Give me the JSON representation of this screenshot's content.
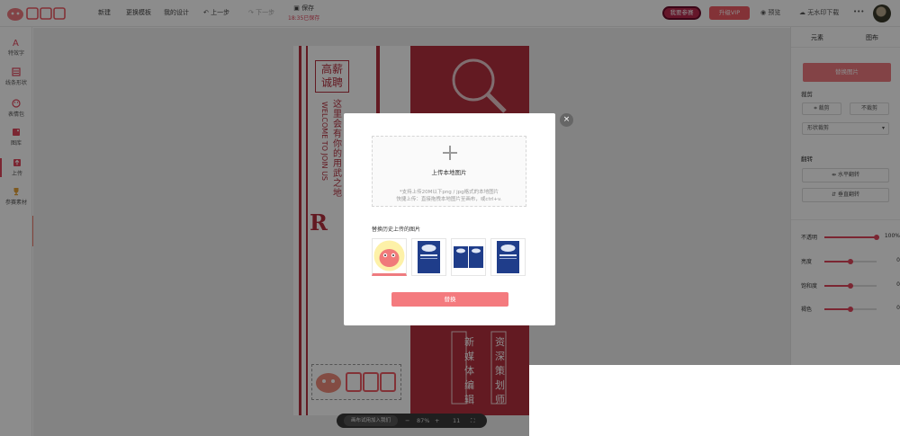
{
  "header": {
    "menu": [
      "新建",
      "更换模板",
      "我的设计"
    ],
    "undo": "上一步",
    "redo": "下一步",
    "save": "保存",
    "save_time": "18:35已保存",
    "member_btn": "我要参赛",
    "vip_btn": "升级VIP",
    "preview": "预览",
    "download": "无水印下载",
    "more": "•••"
  },
  "sidebar": {
    "items": [
      {
        "label": "特效字",
        "icon": "text-effect-icon"
      },
      {
        "label": "线条形状",
        "icon": "shape-icon"
      },
      {
        "label": "表情包",
        "icon": "emoji-icon"
      },
      {
        "label": "图库",
        "icon": "gallery-icon"
      },
      {
        "label": "上传",
        "icon": "upload-icon"
      },
      {
        "label": "参赛素材",
        "icon": "trophy-icon"
      }
    ],
    "collapse": "›"
  },
  "poster": {
    "title_box": "高薪\n诚聘",
    "body_cn": "这里会有你的用武之地",
    "body_en": "WELCOME TO JOIN US",
    "big_letters": "R I",
    "col1": "新媒体编辑",
    "col2": "资深策划师",
    "watermark": "图怪兽"
  },
  "right_panel": {
    "tabs": [
      "元素",
      "图布"
    ],
    "replace_btn": "替换图片",
    "crop_label": "裁剪",
    "crop_btn": "裁剪",
    "no_crop_btn": "不裁剪",
    "shape_crop": "形状裁剪",
    "flip_label": "翻转",
    "flip_h": "水平翻转",
    "flip_v": "垂直翻转",
    "sliders": [
      {
        "label": "不透明",
        "value": "100%",
        "level": 1.0
      },
      {
        "label": "亮度",
        "value": "0",
        "level": 0.5
      },
      {
        "label": "饱和度",
        "value": "0",
        "level": 0.5
      },
      {
        "label": "褐色",
        "value": "0",
        "level": 0.5
      }
    ]
  },
  "dialog": {
    "upload_title": "上传本地图片",
    "hint1": "*支持上传20M以下png / jpg格式的本地图片",
    "hint2": "快捷上传：直接拖拽本地图片至画布，或ctrl+v.",
    "history_title": "替换历史上传的图片",
    "replace_btn": "替换",
    "close": "×"
  },
  "zoombar": {
    "chip": "画布试用加入我们",
    "minus": "−",
    "zoom": "87%",
    "plus": "+",
    "pages": "11"
  },
  "colors": {
    "accent": "#e0455b",
    "poster_red": "#b5303f",
    "button": "#ef7b80"
  }
}
